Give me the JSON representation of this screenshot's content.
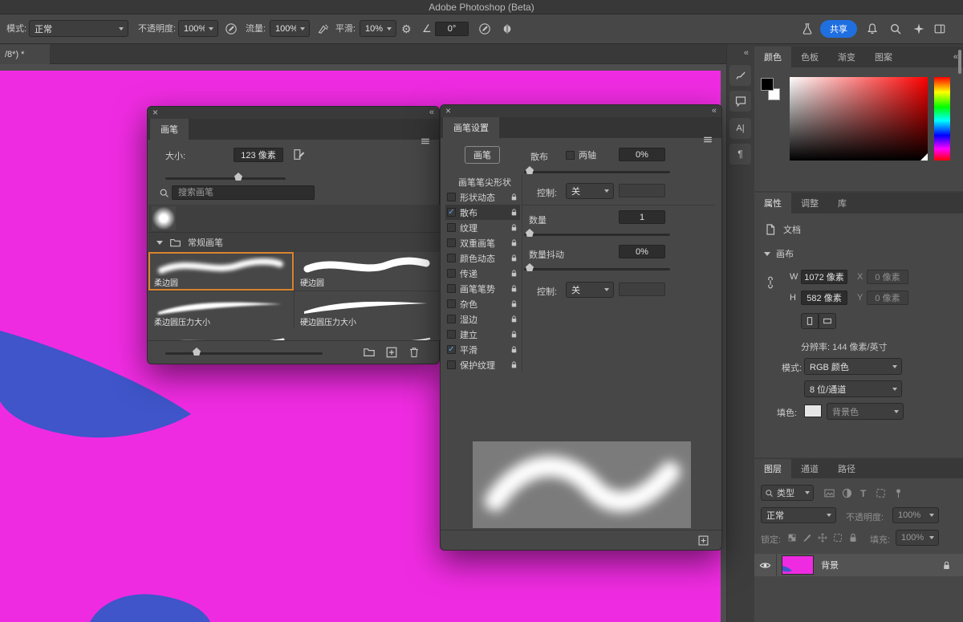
{
  "titlebar": {
    "title": "Adobe Photoshop (Beta)"
  },
  "options": {
    "mode_label": "模式:",
    "mode_value": "正常",
    "opacity_label": "不透明度:",
    "opacity_value": "100%",
    "flow_label": "流量:",
    "flow_value": "100%",
    "smooth_label": "平滑:",
    "smooth_value": "10%",
    "angle_glyph": "∠",
    "angle_value": "0°",
    "gear_glyph": "⚙",
    "share_label": "共享"
  },
  "doc_tab": {
    "label": "/8*) *"
  },
  "rail": {
    "collapse": "«",
    "char_icon": "A|",
    "para_icon": "¶"
  },
  "glyphs": {
    "close": "×",
    "collapse": "«",
    "check": "✓"
  },
  "brushes": {
    "tab": "画笔",
    "size_label": "大小:",
    "size_value": "123 像素",
    "search_placeholder": "搜索画笔",
    "group_label": "常规画笔",
    "presets": [
      {
        "name": "柔边圆"
      },
      {
        "name": "硬边圆"
      },
      {
        "name": "柔边圆压力大小"
      },
      {
        "name": "硬边圆压力大小"
      }
    ]
  },
  "brush_settings": {
    "tab": "画笔设置",
    "brush_button": "画笔",
    "tip_shape_item": "画笔笔尖形状",
    "items": [
      {
        "label": "形状动态",
        "checked": false
      },
      {
        "label": "散布",
        "checked": true,
        "selected": true
      },
      {
        "label": "纹理",
        "checked": false
      },
      {
        "label": "双重画笔",
        "checked": false
      },
      {
        "label": "颜色动态",
        "checked": false
      },
      {
        "label": "传递",
        "checked": false
      },
      {
        "label": "画笔笔势",
        "checked": false
      },
      {
        "label": "杂色",
        "checked": false
      },
      {
        "label": "湿边",
        "checked": false
      },
      {
        "label": "建立",
        "checked": false
      },
      {
        "label": "平滑",
        "checked": true
      },
      {
        "label": "保护纹理",
        "checked": false
      }
    ],
    "scatter_label": "散布",
    "both_axes_label": "两轴",
    "scatter_value": "0%",
    "control_label": "控制:",
    "control_value": "关",
    "count_label": "数量",
    "count_value": "1",
    "count_jitter_label": "数量抖动",
    "count_jitter_value": "0%",
    "control2_label": "控制:",
    "control2_value": "关"
  },
  "color_panel": {
    "tabs": [
      "颜色",
      "色板",
      "渐变",
      "图案"
    ]
  },
  "properties": {
    "tabs": [
      "属性",
      "调整",
      "库"
    ],
    "document_label": "文档",
    "canvas_label": "画布",
    "w_label": "W",
    "w_value": "1072 像素",
    "x_label": "X",
    "x_value": "0 像素",
    "h_label": "H",
    "h_value": "582 像素",
    "y_label": "Y",
    "y_value": "0 像素",
    "resolution_label": "分辨率: 144 像素/英寸",
    "mode_label": "模式:",
    "mode_value": "RGB 颜色",
    "depth_value": "8 位/通道",
    "fill_label": "填色:",
    "fill_value": "背景色"
  },
  "layers": {
    "tabs": [
      "图层",
      "通道",
      "路径"
    ],
    "filter_type_label": "类型",
    "blend_value": "正常",
    "opacity_label": "不透明度:",
    "opacity_value": "100%",
    "lock_label": "锁定:",
    "fill_label": "填充:",
    "fill_value": "100%",
    "layer_name": "背景",
    "type_icon": "T"
  },
  "colors": {
    "canvas_magenta": "#ef2be1",
    "shape_blue": "#3f55c9",
    "accent_blue": "#1f6fe0",
    "selection_orange": "#d9842f"
  }
}
